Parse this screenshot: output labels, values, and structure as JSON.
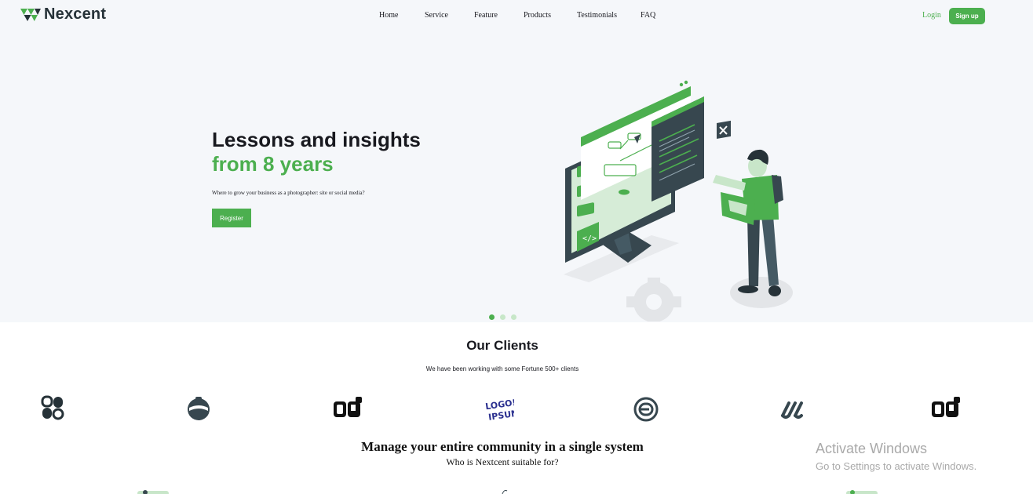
{
  "header": {
    "brand": "Nexcent",
    "nav": [
      "Home",
      "Service",
      "Feature",
      "Products",
      "Testimonials",
      "FAQ"
    ],
    "login": "Login",
    "signup": "Sign up"
  },
  "hero": {
    "title_line1": "Lessons and insights",
    "title_line2": "from 8 years",
    "subtitle": "Where to grow your business as a photographer: site or social media?",
    "cta": "Register",
    "slides": 3,
    "active_slide": 1
  },
  "clients": {
    "title": "Our Clients",
    "subtitle": "We have been working with some Fortune 500+ clients",
    "logos": [
      "client-logo-1-icon",
      "client-logo-2-icon",
      "client-logo-3-icon",
      "client-logo-4-icon",
      "client-logo-5-icon",
      "client-logo-6-icon",
      "client-logo-7-icon"
    ],
    "logo4_text_top": "LOGO!",
    "logo4_text_bottom": "IPSUM"
  },
  "community": {
    "title": "Manage your entire community in a single system",
    "subtitle": "Who is Nextcent suitable for?"
  },
  "watermark": {
    "line1": "Activate Windows",
    "line2": "Go to Settings to activate Windows."
  },
  "colors": {
    "accent": "#4caf4f",
    "dark": "#263238",
    "hero_bg": "#f5f7fa"
  }
}
